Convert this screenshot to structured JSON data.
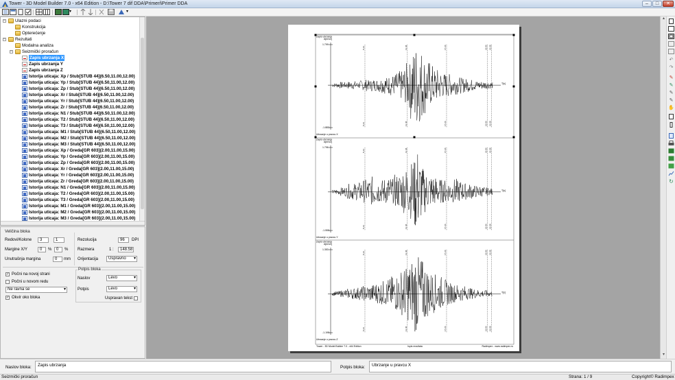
{
  "window": {
    "title": "Tower - 3D Model Builder 7.0 - x64 Edition - D:\\Tower 7 dif DDA\\Primeri\\Primer DDA",
    "buttons": {
      "minimize": "–",
      "maximize": "□",
      "close": "✕"
    }
  },
  "tree": {
    "nodes": [
      {
        "label": "Ulazni podaci",
        "level": 0,
        "icon": "folder-icon",
        "expander": "−",
        "bold": false
      },
      {
        "label": "Konstrukcija",
        "level": 1,
        "icon": "folder-icon",
        "bold": false
      },
      {
        "label": "Opterećenje",
        "level": 1,
        "icon": "folder-icon",
        "bold": false
      },
      {
        "label": "Rezultati",
        "level": 0,
        "icon": "folder-icon",
        "expander": "−",
        "bold": false
      },
      {
        "label": "Modalna analiza",
        "level": 1,
        "icon": "folder-icon",
        "bold": false
      },
      {
        "label": "Seizmički proračun",
        "level": 1,
        "icon": "folder-icon",
        "expander": "−",
        "bold": false
      },
      {
        "label": "Zapis ubrzanja X",
        "level": 2,
        "icon": "seismic-record-icon",
        "bold": true,
        "selected": true
      },
      {
        "label": "Zapis ubrzanja Y",
        "level": 2,
        "icon": "seismic-record-icon",
        "bold": true
      },
      {
        "label": "Zapis ubrzanja Z",
        "level": 2,
        "icon": "seismic-record-icon",
        "bold": true
      },
      {
        "label": "Istorija uticaja: Xp / Stub[STUB 44](6.50,11.00,12.00)",
        "level": 2,
        "icon": "document-icon",
        "bold": true
      },
      {
        "label": "Istorija uticaja: Yp / Stub[STUB 44](6.50,11.00,12.00)",
        "level": 2,
        "icon": "document-icon",
        "bold": true
      },
      {
        "label": "Istorija uticaja: Zp / Stub[STUB 44](6.50,11.00,12.00)",
        "level": 2,
        "icon": "document-icon",
        "bold": true
      },
      {
        "label": "Istorija uticaja: Xr / Stub[STUB 44](6.50,11.00,12.00)",
        "level": 2,
        "icon": "document-icon",
        "bold": true
      },
      {
        "label": "Istorija uticaja: Yr / Stub[STUB 44](6.50,11.00,12.00)",
        "level": 2,
        "icon": "document-icon",
        "bold": true
      },
      {
        "label": "Istorija uticaja: Zr / Stub[STUB 44](6.50,11.00,12.00)",
        "level": 2,
        "icon": "document-icon",
        "bold": true
      },
      {
        "label": "Istorija uticaja: N1 / Stub[STUB 44](6.50,11.00,12.00)",
        "level": 2,
        "icon": "document-icon",
        "bold": true
      },
      {
        "label": "Istorija uticaja: T2 / Stub[STUB 44](6.50,11.00,12.00)",
        "level": 2,
        "icon": "document-icon",
        "bold": true
      },
      {
        "label": "Istorija uticaja: T3 / Stub[STUB 44](6.50,11.00,12.00)",
        "level": 2,
        "icon": "document-icon",
        "bold": true
      },
      {
        "label": "Istorija uticaja: M1 / Stub[STUB 44](6.50,11.00,12.00)",
        "level": 2,
        "icon": "document-icon",
        "bold": true
      },
      {
        "label": "Istorija uticaja: M2 / Stub[STUB 44](6.50,11.00,12.00)",
        "level": 2,
        "icon": "document-icon",
        "bold": true
      },
      {
        "label": "Istorija uticaja: M3 / Stub[STUB 44](6.50,11.00,12.00)",
        "level": 2,
        "icon": "document-icon",
        "bold": true
      },
      {
        "label": "Istorija uticaja: Xp / Greda[GR 603](2.00,11.00,15.00)",
        "level": 2,
        "icon": "document-icon",
        "bold": true
      },
      {
        "label": "Istorija uticaja: Yp / Greda[GR 603](2.00,11.00,15.00)",
        "level": 2,
        "icon": "document-icon",
        "bold": true
      },
      {
        "label": "Istorija uticaja: Zp / Greda[GR 603](2.00,11.00,15.00)",
        "level": 2,
        "icon": "document-icon",
        "bold": true
      },
      {
        "label": "Istorija uticaja: Xr / Greda[GR 603](2.00,11.00,15.00)",
        "level": 2,
        "icon": "document-icon",
        "bold": true
      },
      {
        "label": "Istorija uticaja: Yr / Greda[GR 603](2.00,11.00,15.00)",
        "level": 2,
        "icon": "document-icon",
        "bold": true
      },
      {
        "label": "Istorija uticaja: Zr / Greda[GR 603](2.00,11.00,15.00)",
        "level": 2,
        "icon": "document-icon",
        "bold": true
      },
      {
        "label": "Istorija uticaja: N1 / Greda[GR 603](2.00,11.00,15.00)",
        "level": 2,
        "icon": "document-icon",
        "bold": true
      },
      {
        "label": "Istorija uticaja: T2 / Greda[GR 603](2.00,11.00,15.00)",
        "level": 2,
        "icon": "document-icon",
        "bold": true
      },
      {
        "label": "Istorija uticaja: T3 / Greda[GR 603](2.00,11.00,15.00)",
        "level": 2,
        "icon": "document-icon",
        "bold": true
      },
      {
        "label": "Istorija uticaja: M1 / Greda[GR 603](2.00,11.00,15.00)",
        "level": 2,
        "icon": "document-icon",
        "bold": true
      },
      {
        "label": "Istorija uticaja: M2 / Greda[GR 603](2.00,11.00,15.00)",
        "level": 2,
        "icon": "document-icon",
        "bold": true
      },
      {
        "label": "Istorija uticaja: M3 / Greda[GR 603](2.00,11.00,15.00)",
        "level": 2,
        "icon": "document-icon",
        "bold": true
      }
    ]
  },
  "props": {
    "block_size_title": "Veličina bloka",
    "rows_cols_label": "Redovi/Kolone",
    "rows_value": "3",
    "cols_value": "1",
    "margins_label": "Margine X/Y",
    "margin_x": "0",
    "margin_y": "0",
    "pct": "%",
    "inner_margin_label": "Unutrašnja margina",
    "inner_margin_value": "0",
    "mm": "mm",
    "resolution_label": "Rezolucija",
    "resolution_value": "96",
    "dpi": "DPI",
    "scale_label": "Razmera",
    "scale_prefix": "1 :",
    "scale_value": "148.58",
    "orientation_label": "Orijentacija",
    "orientation_value": "Uspravno",
    "new_page_label": "Počni na novoj strani",
    "new_page_checked": "✓",
    "new_row_label": "Počni u novom redu",
    "align_value": "Ne ravna se",
    "border_label": "Okvir oko bloka",
    "border_checked": "✓",
    "caption_group": "Potpis bloka",
    "title_label": "Naslov",
    "title_value": "Levo",
    "caption_label": "Potpis",
    "caption_value": "Levo",
    "vertical_text_label": "Uspravan tekst"
  },
  "captions": {
    "block_title_label": "Naslov bloka:",
    "block_title_value": "Zapis ubrzanja",
    "block_caption_label": "Potpis bloka:",
    "block_caption_value": "Ubrzanje u pravcu X"
  },
  "status": {
    "left": "Seizmički proračun",
    "page": "Strana: 1 / 9",
    "copyright": "Copyright© Radimpex"
  },
  "page_footer": {
    "left": "Tower - 3D Model Builder 7.0 - x64 Edition",
    "center": "Ispis rezultata",
    "right": "Radimpex - www.radimpex.rs"
  },
  "chart_data": [
    {
      "type": "line",
      "title": "Zapis ubrzanja",
      "ylabel": "A[m/s2]",
      "xlabel": "T[s]",
      "caption": "Ubrzanje u pravcu X",
      "ymax_label": "1.799",
      "ymin_label": "-1.883",
      "ylim": [
        -1.883,
        1.799
      ],
      "x_markers": [
        "5.14",
        "11.46",
        "17.24",
        "22.86",
        "23.08"
      ],
      "y_extent": [
        -1.883,
        1.799
      ],
      "envelope": [
        0.05,
        0.06,
        0.08,
        0.07,
        0.09,
        0.1,
        0.08,
        0.12,
        0.14,
        0.12,
        0.15,
        0.14,
        0.18,
        0.2,
        0.22,
        0.25,
        0.3,
        0.35,
        0.45,
        0.55,
        0.85,
        1.0,
        0.9,
        0.7,
        0.6,
        0.5,
        0.4,
        0.35,
        0.3,
        0.28,
        0.25,
        0.22,
        0.2,
        0.18,
        0.16,
        0.14,
        0.12,
        0.1,
        0.1,
        0.09,
        0.08,
        0.07
      ]
    },
    {
      "type": "line",
      "title": "Zapis ubrzanja",
      "ylabel": "A[m/s2]",
      "xlabel": "T[s]",
      "caption": "Ubrzanje u pravcu Y",
      "ymax_label": "1.796",
      "ymin_label": "-1.555",
      "ylim": [
        -1.555,
        1.796
      ],
      "x_markers": [
        "5.14",
        "11.46",
        "17.24",
        "22.86",
        "23.08"
      ],
      "y_extent": [
        -1.555,
        1.796
      ],
      "envelope": [
        0.05,
        0.07,
        0.1,
        0.12,
        0.18,
        0.2,
        0.22,
        0.25,
        0.28,
        0.3,
        0.35,
        0.3,
        0.28,
        0.32,
        0.35,
        0.3,
        0.4,
        0.45,
        0.55,
        0.6,
        0.7,
        1.0,
        0.75,
        0.55,
        0.45,
        0.4,
        0.35,
        0.3,
        0.28,
        0.25,
        0.28,
        0.3,
        0.26,
        0.22,
        0.2,
        0.18,
        0.15,
        0.14,
        0.12,
        0.1,
        0.08,
        0.07
      ]
    },
    {
      "type": "line",
      "title": "Zapis ubrzanja",
      "ylabel": "A[m/s2]",
      "xlabel": "T[s]",
      "caption": "Ubrzanje u pravcu Z",
      "ymax_label": "1.353",
      "ymin_label": "-1.195",
      "ylim": [
        -1.195,
        1.353
      ],
      "x_markers": [
        "5.14",
        "11.46",
        "17.24",
        "22.86",
        "23.08"
      ],
      "y_extent": [
        -1.195,
        1.353
      ],
      "envelope": [
        0.05,
        0.06,
        0.08,
        0.1,
        0.12,
        0.14,
        0.15,
        0.16,
        0.18,
        0.2,
        0.22,
        0.25,
        0.28,
        0.3,
        0.35,
        0.4,
        0.45,
        0.55,
        0.6,
        0.7,
        0.8,
        1.0,
        0.85,
        0.75,
        0.6,
        0.5,
        0.45,
        0.4,
        0.35,
        0.3,
        0.25,
        0.22,
        0.2,
        0.18,
        0.15,
        0.13,
        0.12,
        0.1,
        0.09,
        0.08,
        0.07,
        0.06
      ]
    }
  ],
  "colors": {
    "selection": "#3399ff",
    "preview_bg": "#a4a4a4",
    "trace": "#000000",
    "marker_line": "#000000"
  }
}
